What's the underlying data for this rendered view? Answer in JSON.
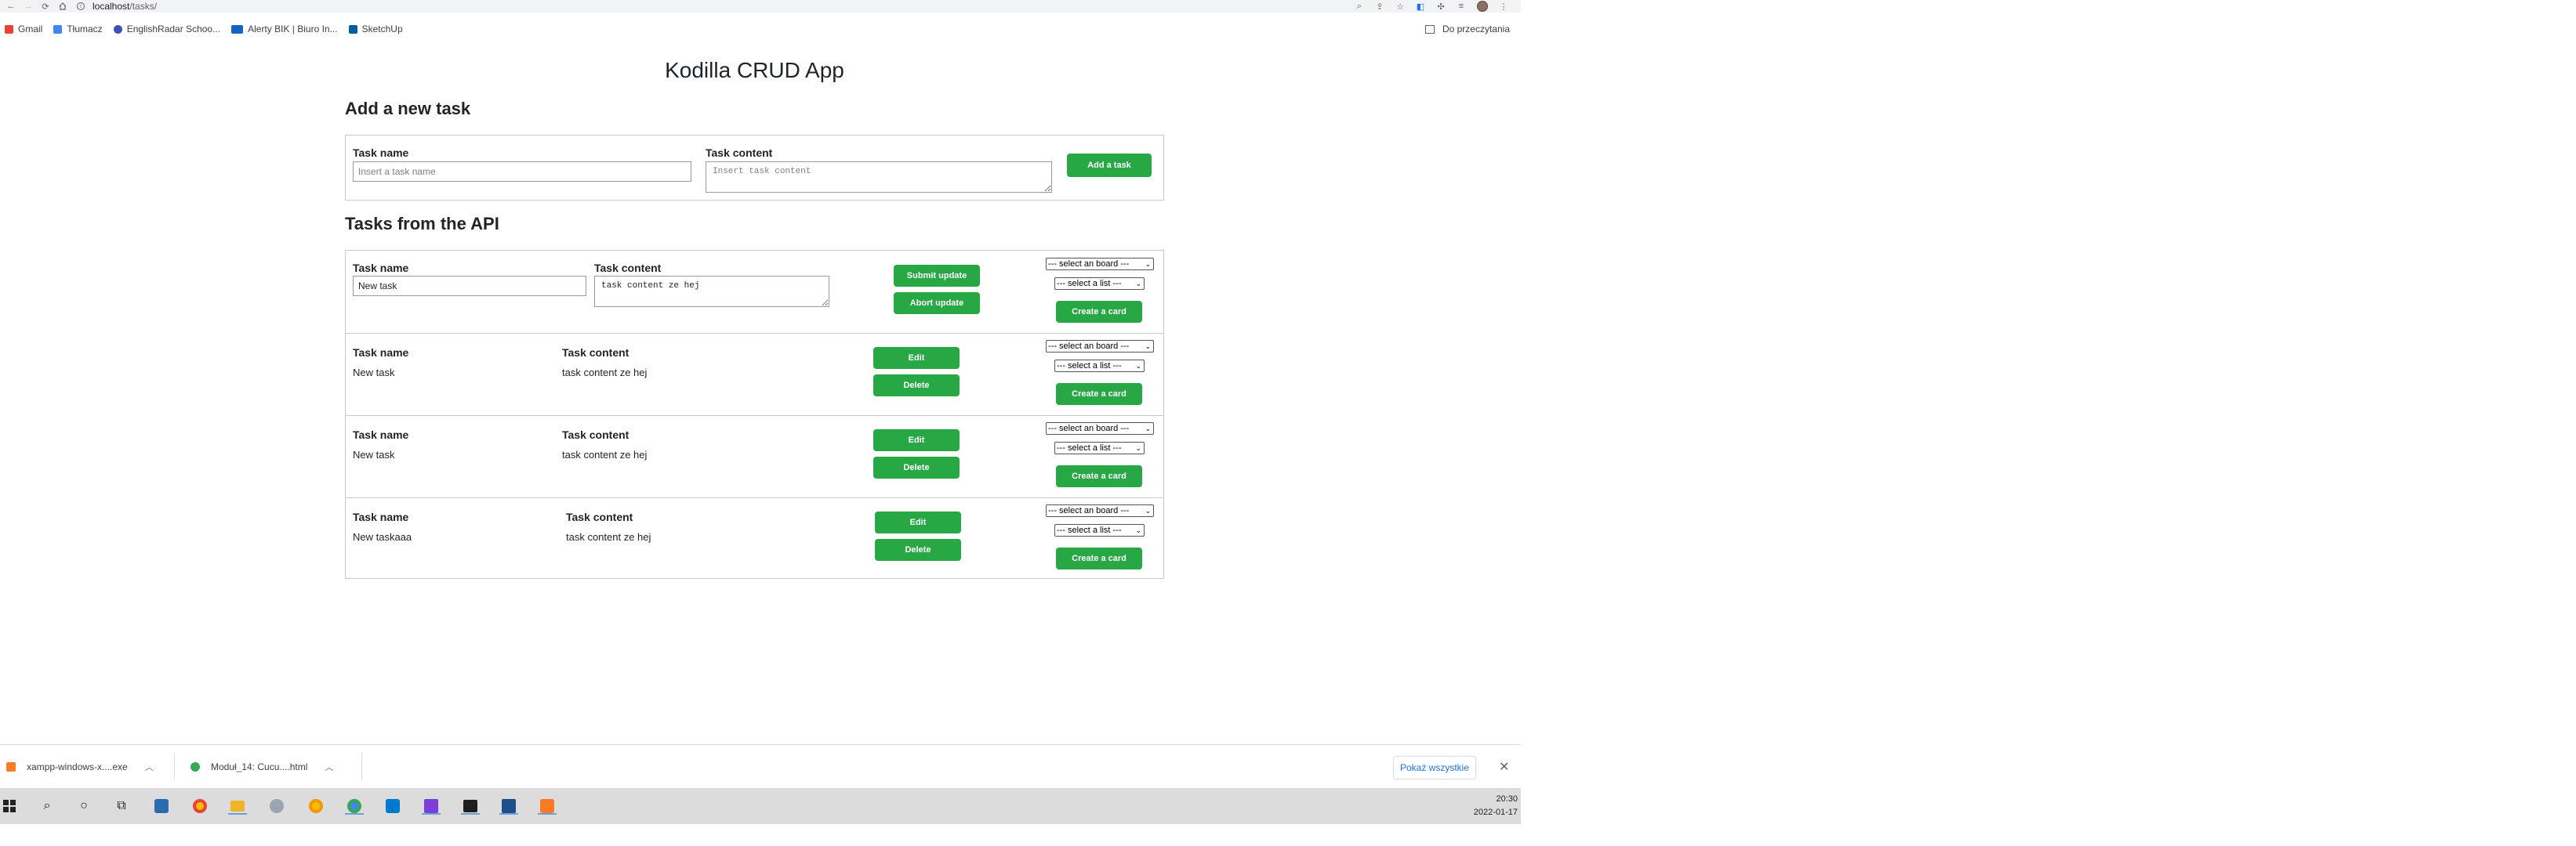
{
  "browser": {
    "url_host": "localhost",
    "url_path": "/tasks/",
    "bookmarks": [
      {
        "label": "Gmail",
        "color": "#ea4335"
      },
      {
        "label": "Tłumacz",
        "color": "#4285f4"
      },
      {
        "label": "EnglishRadar Schoo...",
        "color": "#3f51b5"
      },
      {
        "label": "Alerty BIK | Biuro In...",
        "color": "#1565c0"
      },
      {
        "label": "SketchUp",
        "color": "#005f9e"
      }
    ],
    "reading_list": "Do przeczytania"
  },
  "page": {
    "title": "Kodilla CRUD App",
    "add_heading": "Add a new task",
    "tasks_heading": "Tasks from the API"
  },
  "add_form": {
    "name_label": "Task name",
    "name_placeholder": "Insert a task name",
    "content_label": "Task content",
    "content_placeholder": "Insert task content",
    "add_button": "Add a task"
  },
  "common": {
    "name_label": "Task name",
    "content_label": "Task content",
    "board_select": "--- select an board ---",
    "list_select": "--- select a list ---",
    "create_card": "Create a card",
    "edit": "Edit",
    "delete": "Delete",
    "submit_update": "Submit update",
    "abort_update": "Abort update"
  },
  "tasks": [
    {
      "name": "New task",
      "content": "task content ze hej",
      "editing": true
    },
    {
      "name": "New task",
      "content": "task content ze hej",
      "editing": false
    },
    {
      "name": "New task",
      "content": "task content ze hej",
      "editing": false
    },
    {
      "name": "New taskaaa",
      "content": "task content ze hej",
      "editing": false
    }
  ],
  "downloads": {
    "items": [
      {
        "label": "xampp-windows-x....exe"
      },
      {
        "label": "Moduł_14: Cucu....html"
      }
    ],
    "show_all": "Pokaż wszystkie"
  },
  "taskbar": {
    "time": "20:30",
    "date": "2022-01-17"
  },
  "colors": {
    "accent_green": "#28a745",
    "link_blue": "#1a73e8"
  }
}
